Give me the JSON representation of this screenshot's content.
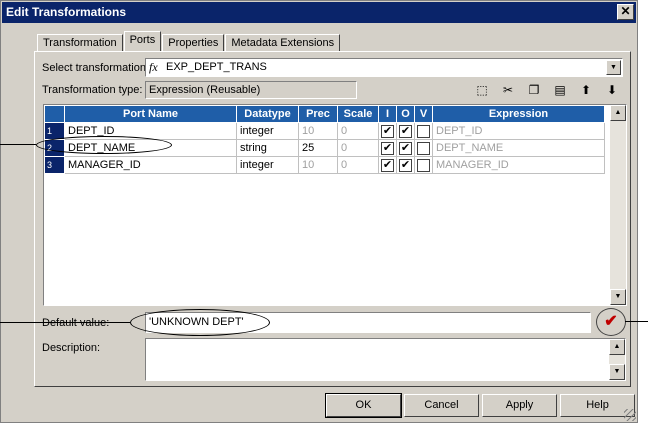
{
  "window": {
    "title": "Edit Transformations",
    "close_glyph": "✕"
  },
  "tabs": [
    {
      "label": "Transformation"
    },
    {
      "label": "Ports"
    },
    {
      "label": "Properties"
    },
    {
      "label": "Metadata Extensions"
    }
  ],
  "form": {
    "select_label": "Select transformation:",
    "select_value": "EXP_DEPT_TRANS",
    "select_icon": "fx-icon",
    "type_label": "Transformation type:",
    "type_value": "Expression (Reusable)",
    "default_label": "Default value:",
    "default_value": "'UNKNOWN DEPT'",
    "description_label": "Description:",
    "description_value": ""
  },
  "toolbar": [
    "new-port-icon",
    "cut-icon",
    "copy-icon",
    "paste-icon",
    "move-up-icon",
    "move-down-icon"
  ],
  "grid": {
    "columns": [
      "Port Name",
      "Datatype",
      "Prec",
      "Scale",
      "I",
      "O",
      "V",
      "Expression"
    ],
    "rows": [
      {
        "n": "1",
        "name": "DEPT_ID",
        "type": "integer",
        "prec": "10",
        "scale": "0",
        "i": true,
        "o": true,
        "v": false,
        "expr": "DEPT_ID"
      },
      {
        "n": "2",
        "name": "DEPT_NAME",
        "type": "string",
        "prec": "25",
        "scale": "0",
        "i": true,
        "o": true,
        "v": false,
        "expr": "DEPT_NAME"
      },
      {
        "n": "3",
        "name": "MANAGER_ID",
        "type": "integer",
        "prec": "10",
        "scale": "0",
        "i": true,
        "o": true,
        "v": false,
        "expr": "MANAGER_ID"
      }
    ]
  },
  "buttons": {
    "ok": "OK",
    "cancel": "Cancel",
    "apply": "Apply",
    "help": "Help"
  },
  "validate_glyph": "✔",
  "colors": {
    "title_bar": "#0a246a",
    "header": "#1f5ea8",
    "dialog_bg": "#d4d0c8",
    "validate": "#c00000"
  }
}
